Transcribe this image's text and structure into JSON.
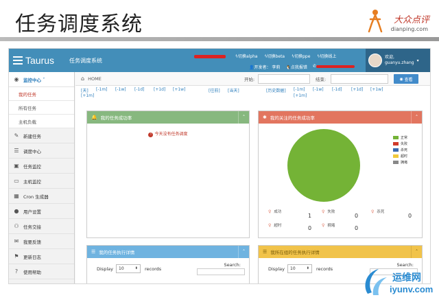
{
  "slide": {
    "title": "任务调度系统"
  },
  "brand": {
    "name_cn": "大众点评",
    "domain": "dianping.com"
  },
  "navbar": {
    "logo": "Taurus",
    "app_name": "任务调度系统",
    "env_links": [
      "切换alpha",
      "切换beta",
      "切换ppe",
      "切换线上"
    ],
    "developer_label": "开发者：",
    "developer_name": "李莉",
    "penguin_label": "点我报错",
    "user_greeting": "欢迎,",
    "user_name": "guanyu.zhang"
  },
  "sidebar": {
    "items": [
      {
        "label": "监控中心",
        "icon": "dashboard-icon"
      },
      {
        "label": "新建任务",
        "icon": "edit-icon"
      },
      {
        "label": "调度中心",
        "icon": "list-icon"
      },
      {
        "label": "任务监控",
        "icon": "monitor-icon"
      },
      {
        "label": "主机监控",
        "icon": "desktop-icon"
      },
      {
        "label": "Cron 生成器",
        "icon": "calendar-icon"
      },
      {
        "label": "用户设置",
        "icon": "user-icon"
      },
      {
        "label": "任务交接",
        "icon": "group-icon"
      },
      {
        "label": "我要反馈",
        "icon": "comment-icon"
      },
      {
        "label": "更新日志",
        "icon": "tag-icon"
      },
      {
        "label": "使用帮助",
        "icon": "question-icon"
      }
    ],
    "sub_items": [
      "我的任务",
      "所有任务",
      "主机负载"
    ]
  },
  "topbar": {
    "home": "HOME",
    "start_label": "开始:",
    "end_label": "结束:",
    "query_button": "查看"
  },
  "filters": {
    "row1": [
      "[天]",
      "[-1m]",
      "[-1w]",
      "[-1d]",
      "[+1d]",
      "[+1w]",
      "[往前]",
      "[当天]",
      "[历史数据]",
      "[-1m]",
      "[-1w]",
      "[-1d]",
      "[+1d]",
      "[+1w]"
    ],
    "row2": [
      "[+1m]",
      "[+1m]"
    ]
  },
  "panels": {
    "my_success": {
      "title": "我的任务成功率",
      "message": "今天没有任务调度"
    },
    "follow_success": {
      "title": "我的关注的任务成功率"
    },
    "my_details": {
      "title": "我的任务执行详情"
    },
    "all_details": {
      "title": "我所在组的任务执行详情"
    }
  },
  "chart_data": {
    "type": "pie",
    "legend": [
      "正常",
      "失败",
      "杀死",
      "超时",
      "拥堵"
    ],
    "colors": [
      "#74b336",
      "#d13b2a",
      "#3a6ab0",
      "#f0c93c",
      "#888888"
    ],
    "values": [
      1,
      0,
      0,
      0,
      0
    ]
  },
  "stats": {
    "success_label": "成功",
    "success_value": "1",
    "fail_label": "失败",
    "fail_value": "0",
    "kill_label": "杀死",
    "kill_value": "0",
    "timeout_label": "超时",
    "timeout_value": "0",
    "jam_label": "拥堵",
    "jam_value": "0"
  },
  "table": {
    "display_label": "Display",
    "records_value": "10",
    "records_label": "records",
    "search_label": "Search:"
  },
  "watermark": {
    "cn": "运维网",
    "en": "iyunv.com"
  }
}
